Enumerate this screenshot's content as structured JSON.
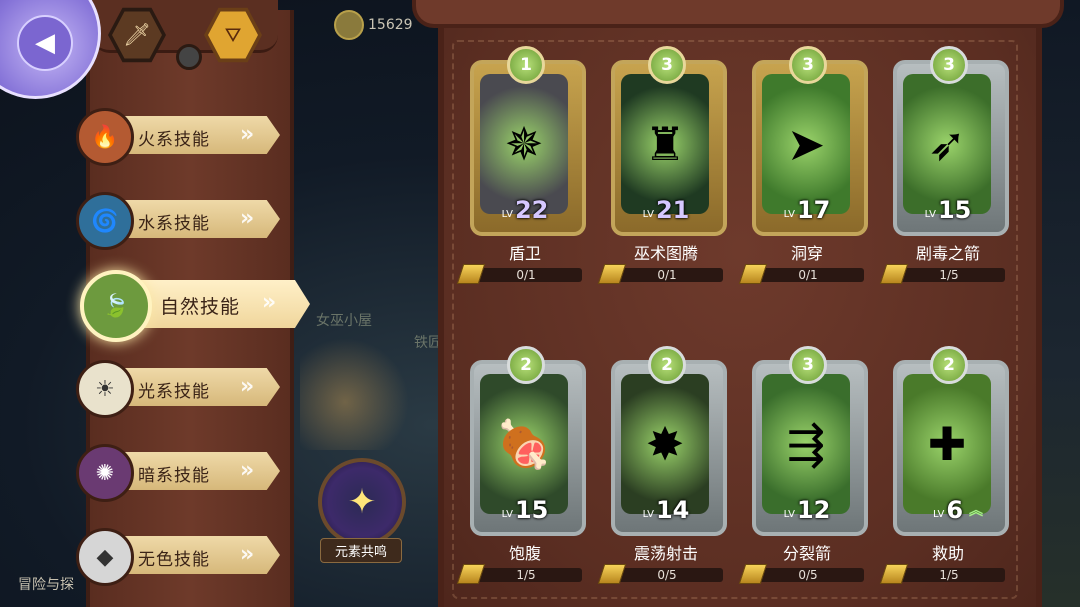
{
  "currency": {
    "value": "15629"
  },
  "top_tabs": [
    {
      "icon": "sword-icon",
      "glyph": "🗡",
      "active": false
    },
    {
      "icon": "element-icon",
      "glyph": "⛛",
      "active": true
    }
  ],
  "skill_categories": [
    {
      "id": "fire",
      "label": "火系技能",
      "icon": "fire-element-icon",
      "glyph": "🔥",
      "color": "#b45a32",
      "active": false
    },
    {
      "id": "water",
      "label": "水系技能",
      "icon": "water-element-icon",
      "glyph": "🌀",
      "color": "#2f6f9a",
      "active": false
    },
    {
      "id": "nature",
      "label": "自然技能",
      "icon": "nature-element-icon",
      "glyph": "🍃",
      "color": "#6d9a3e",
      "active": true
    },
    {
      "id": "light",
      "label": "光系技能",
      "icon": "light-element-icon",
      "glyph": "☀",
      "color": "#e9e2cc",
      "active": false
    },
    {
      "id": "dark",
      "label": "暗系技能",
      "icon": "dark-element-icon",
      "glyph": "✺",
      "color": "#6a3a72",
      "active": false
    },
    {
      "id": "neutral",
      "label": "无色技能",
      "icon": "neutral-element-icon",
      "glyph": "◆",
      "color": "#d6d6d6",
      "active": false
    }
  ],
  "map_labels": {
    "house": "女巫小屋",
    "iron": "铁匠",
    "adventure": "冒险与探"
  },
  "resonance": {
    "label": "元素共鸣",
    "glyph": "✦"
  },
  "cards": [
    {
      "name": "盾卫",
      "level": "22",
      "level_prefix": "LV",
      "rank": "1",
      "progress": "0/1",
      "frame": "gold",
      "icon": "shield-spin-icon",
      "glyph": "✵",
      "art_color": "#4a4a50",
      "level_color": "purple"
    },
    {
      "name": "巫术图腾",
      "level": "21",
      "level_prefix": "LV",
      "rank": "3",
      "progress": "0/1",
      "frame": "gold",
      "icon": "totem-icon",
      "glyph": "♜",
      "art_color": "#1f3a22",
      "level_color": "purple"
    },
    {
      "name": "洞穿",
      "level": "17",
      "level_prefix": "LV",
      "rank": "3",
      "progress": "0/1",
      "frame": "gold",
      "icon": "pierce-arrow-icon",
      "glyph": "➤",
      "art_color": "#3f7a2c",
      "level_color": "white"
    },
    {
      "name": "剧毒之箭",
      "level": "15",
      "level_prefix": "LV",
      "rank": "3",
      "progress": "1/5",
      "frame": "silver",
      "icon": "poison-arrow-icon",
      "glyph": "➶",
      "art_color": "#3c6e2a",
      "level_color": "white"
    },
    {
      "name": "饱腹",
      "level": "15",
      "level_prefix": "LV",
      "rank": "2",
      "progress": "1/5",
      "frame": "silver",
      "icon": "meat-icon",
      "glyph": "🍖",
      "art_color": "#2f4a2a",
      "level_color": "white"
    },
    {
      "name": "震荡射击",
      "level": "14",
      "level_prefix": "LV",
      "rank": "2",
      "progress": "0/5",
      "frame": "silver",
      "icon": "shock-shot-icon",
      "glyph": "✸",
      "art_color": "#2b3e22",
      "level_color": "white"
    },
    {
      "name": "分裂箭",
      "level": "12",
      "level_prefix": "LV",
      "rank": "3",
      "progress": "0/5",
      "frame": "silver",
      "icon": "split-arrow-icon",
      "glyph": "⇶",
      "art_color": "#3a6e2c",
      "level_color": "white"
    },
    {
      "name": "救助",
      "level": "6",
      "level_prefix": "LV",
      "rank": "2",
      "progress": "1/5",
      "frame": "silver",
      "icon": "heal-heart-icon",
      "glyph": "✚",
      "art_color": "#4a7a2a",
      "level_color": "white",
      "upgradable": true
    }
  ]
}
